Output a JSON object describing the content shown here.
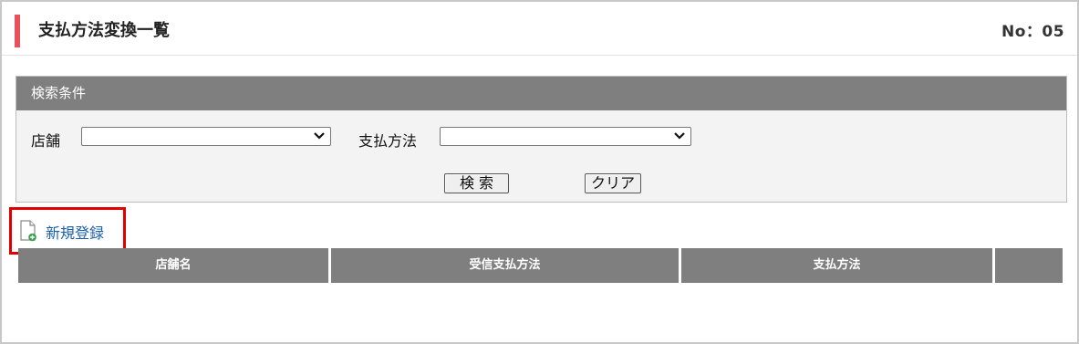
{
  "header": {
    "title": "支払方法変換一覧",
    "screen_no": "No：05"
  },
  "search": {
    "heading": "検索条件",
    "store_label": "店舗",
    "store_value": "",
    "payment_label": "支払方法",
    "payment_value": "",
    "search_button": "検 索",
    "clear_button": "クリア"
  },
  "actions": {
    "new_label": "新規登録"
  },
  "table": {
    "columns": [
      "店舗名",
      "受信支払方法",
      "支払方法",
      ""
    ]
  },
  "colors": {
    "accent": "#e8505b",
    "header_gray": "#7f7f7f",
    "link_blue": "#1a5faa",
    "highlight_red": "#e00000"
  },
  "icons": {
    "select_chevron": "chevron-down-icon",
    "new_record": "document-add-icon"
  }
}
